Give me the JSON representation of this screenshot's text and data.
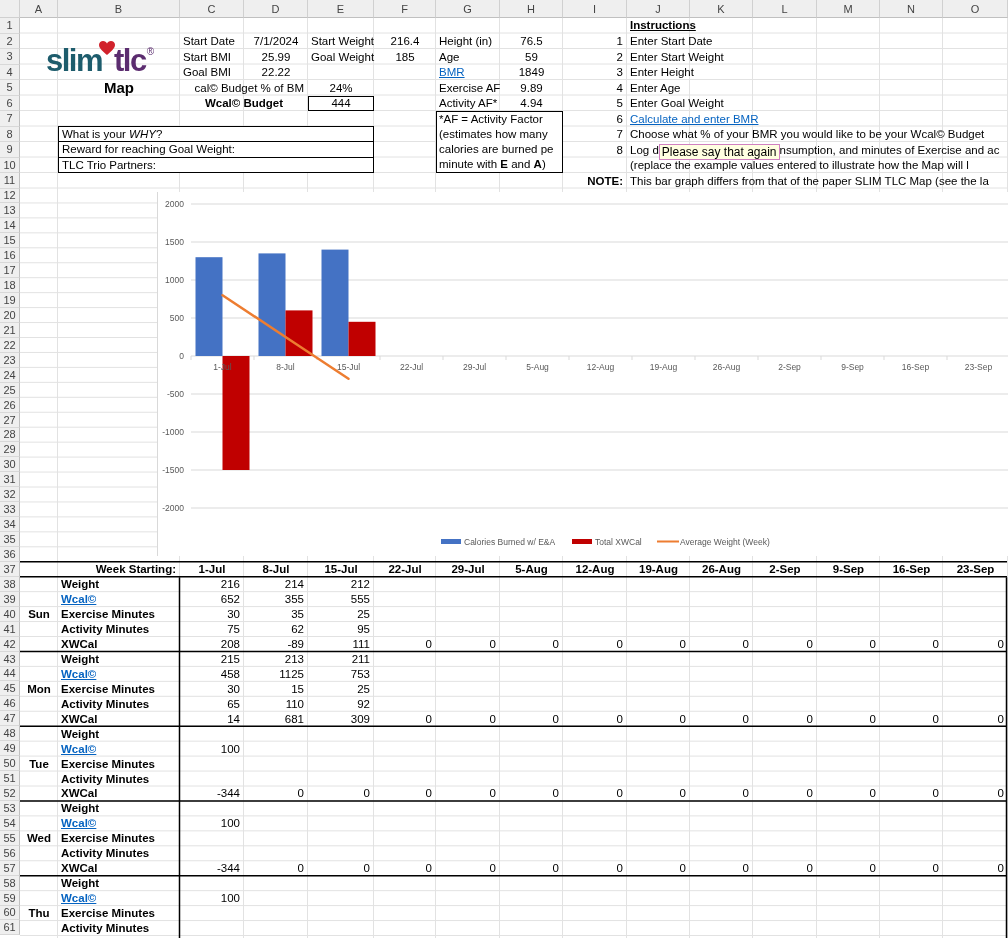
{
  "column_headers": [
    "A",
    "B",
    "C",
    "D",
    "E",
    "F",
    "G",
    "H",
    "I",
    "J",
    "K",
    "L",
    "M",
    "N",
    "O"
  ],
  "row_numbers": [
    "1",
    "2",
    "3",
    "4",
    "5",
    "6",
    "7",
    "8",
    "9",
    "10",
    "11",
    "12",
    "13",
    "14",
    "15",
    "16",
    "17",
    "18",
    "19",
    "20",
    "21",
    "22",
    "23",
    "24",
    "25",
    "26",
    "27",
    "28",
    "29",
    "30",
    "31",
    "32",
    "33",
    "34",
    "35",
    "36",
    "37",
    "38",
    "39",
    "40",
    "41",
    "42",
    "43",
    "44",
    "45",
    "46",
    "47",
    "48",
    "49",
    "50",
    "51",
    "52",
    "53",
    "54",
    "55",
    "56",
    "57",
    "58",
    "59",
    "60",
    "61"
  ],
  "logo": {
    "left": "slim",
    "right": "tlc",
    "mark": "®"
  },
  "map_title": "Map",
  "profile": {
    "left": [
      {
        "label": "Start Date",
        "value": "7/1/2024"
      },
      {
        "label": "Start BMI",
        "value": "25.99"
      },
      {
        "label": "Goal BMI",
        "value": "22.22"
      }
    ],
    "right": [
      {
        "label": "Start Weight",
        "value": "216.4"
      },
      {
        "label": "Goal Weight",
        "value": "185"
      }
    ],
    "budget_percent": {
      "label": "cal© Budget % of BM",
      "value": "24%"
    },
    "budget": {
      "label": "Wcal© Budget",
      "value": "444"
    }
  },
  "prompts": [
    "What is your *WHY*?",
    "Reward for reaching Goal Weight:",
    "TLC Trio Partners:"
  ],
  "metrics": [
    {
      "label": "Height (in)",
      "value": "76.5",
      "kind": "plain"
    },
    {
      "label": "Age",
      "value": "59",
      "kind": "plain"
    },
    {
      "label": "BMR",
      "value": "1849",
      "kind": "link"
    },
    {
      "label": "Exercise AF",
      "value": "9.89",
      "kind": "plain"
    },
    {
      "label": "Activity AF*",
      "value": "4.94",
      "kind": "plain"
    }
  ],
  "af_note": [
    "*AF = Activity Factor",
    "(estimates how many",
    "calories are burned pe",
    "minute with **E** and **A**)"
  ],
  "instructions": {
    "title": "Instructions",
    "steps": [
      {
        "number": "1",
        "text": "Enter Start Date",
        "kind": "plain"
      },
      {
        "number": "2",
        "text": "Enter Start Weight",
        "kind": "plain"
      },
      {
        "number": "3",
        "text": "Enter Height",
        "kind": "plain"
      },
      {
        "number": "4",
        "text": "Enter Age",
        "kind": "plain"
      },
      {
        "number": "5",
        "text": "Enter Goal Weight",
        "kind": "plain"
      },
      {
        "number": "6",
        "text": "Calculate and enter BMR",
        "kind": "link"
      },
      {
        "number": "7",
        "text": "Choose what % of your BMR you would like to be your Wcal© Budget",
        "kind": "plain"
      },
      {
        "number": "8",
        "text": "Log d",
        "kind": "tooltip",
        "tooltip": "Please say that again",
        "text_after": "nsumption, and minutes of Exercise and ac"
      }
    ],
    "continuation": "(replace the example values entered to illustrate how the Map will l",
    "note": {
      "label": "NOTE:",
      "text": "This bar graph differs from that of the paper SLIM TLC Map (see the la"
    }
  },
  "chart": {
    "chart_data": {
      "type": "bar",
      "categories": [
        "1-Jul",
        "8-Jul",
        "15-Jul",
        "22-Jul",
        "29-Jul",
        "5-Aug",
        "12-Aug",
        "19-Aug",
        "26-Aug",
        "2-Sep",
        "9-Sep",
        "16-Sep",
        "23-Sep"
      ],
      "series": [
        {
          "name": "Calories Burned w/ E&A",
          "color": "#4472c4",
          "values": [
            1300,
            1350,
            1400,
            null,
            null,
            null,
            null,
            null,
            null,
            null,
            null,
            null,
            null
          ]
        },
        {
          "name": "Total XWCal",
          "color": "#c00000",
          "values": [
            -1500,
            600,
            450,
            null,
            null,
            null,
            null,
            null,
            null,
            null,
            null,
            null,
            null
          ]
        },
        {
          "name": "Average Weight (Week)",
          "color": "#ed7d31",
          "type": "line",
          "values": [
            800,
            250,
            -300,
            null,
            null,
            null,
            null,
            null,
            null,
            null,
            null,
            null,
            null
          ]
        }
      ],
      "ylim": [
        -2000,
        2000
      ],
      "grid": true,
      "legend": true,
      "yticks": [
        -2000,
        -1500,
        -1000,
        -500,
        0,
        500,
        1000,
        1500,
        2000
      ]
    }
  },
  "week_table": {
    "header": "Week Starting:",
    "weeks": [
      "1-Jul",
      "8-Jul",
      "15-Jul",
      "22-Jul",
      "29-Jul",
      "5-Aug",
      "12-Aug",
      "19-Aug",
      "26-Aug",
      "2-Sep",
      "9-Sep",
      "16-Sep",
      "23-Sep"
    ],
    "days": [
      {
        "day": "Sun",
        "rows": [
          {
            "label": "Weight",
            "kind": "plain",
            "values": [
              "216",
              "214",
              "212"
            ]
          },
          {
            "label": "Wcal©",
            "kind": "link",
            "values": [
              "652",
              "355",
              "555"
            ]
          },
          {
            "label": "Exercise Minutes",
            "kind": "plain",
            "values": [
              "30",
              "35",
              "25"
            ]
          },
          {
            "label": "Activity Minutes",
            "kind": "plain",
            "values": [
              "75",
              "62",
              "95"
            ]
          },
          {
            "label": "XWCal",
            "kind": "plain",
            "values": [
              "208",
              "-89",
              "111",
              "0",
              "0",
              "0",
              "0",
              "0",
              "0",
              "0",
              "0",
              "0",
              "0"
            ]
          }
        ]
      },
      {
        "day": "Mon",
        "rows": [
          {
            "label": "Weight",
            "kind": "plain",
            "values": [
              "215",
              "213",
              "211"
            ]
          },
          {
            "label": "Wcal©",
            "kind": "link",
            "values": [
              "458",
              "1125",
              "753"
            ]
          },
          {
            "label": "Exercise Minutes",
            "kind": "plain",
            "values": [
              "30",
              "15",
              "25"
            ]
          },
          {
            "label": "Activity Minutes",
            "kind": "plain",
            "values": [
              "65",
              "110",
              "92"
            ]
          },
          {
            "label": "XWCal",
            "kind": "plain",
            "values": [
              "14",
              "681",
              "309",
              "0",
              "0",
              "0",
              "0",
              "0",
              "0",
              "0",
              "0",
              "0",
              "0"
            ]
          }
        ]
      },
      {
        "day": "Tue",
        "rows": [
          {
            "label": "Weight",
            "kind": "plain"
          },
          {
            "label": "Wcal©",
            "kind": "link",
            "values": [
              "100"
            ]
          },
          {
            "label": "Exercise Minutes",
            "kind": "plain"
          },
          {
            "label": "Activity Minutes",
            "kind": "plain"
          },
          {
            "label": "XWCal",
            "kind": "plain",
            "values": [
              "-344",
              "0",
              "0",
              "0",
              "0",
              "0",
              "0",
              "0",
              "0",
              "0",
              "0",
              "0",
              "0"
            ]
          }
        ]
      },
      {
        "day": "Wed",
        "rows": [
          {
            "label": "Weight",
            "kind": "plain"
          },
          {
            "label": "Wcal©",
            "kind": "link",
            "values": [
              "100"
            ]
          },
          {
            "label": "Exercise Minutes",
            "kind": "plain"
          },
          {
            "label": "Activity Minutes",
            "kind": "plain"
          },
          {
            "label": "XWCal",
            "kind": "plain",
            "values": [
              "-344",
              "0",
              "0",
              "0",
              "0",
              "0",
              "0",
              "0",
              "0",
              "0",
              "0",
              "0",
              "0"
            ]
          }
        ]
      },
      {
        "day": "Thu",
        "rows": [
          {
            "label": "Weight",
            "kind": "plain"
          },
          {
            "label": "Wcal©",
            "kind": "link",
            "values": [
              "100"
            ]
          },
          {
            "label": "Exercise Minutes",
            "kind": "plain"
          },
          {
            "label": "Activity Minutes",
            "kind": "plain"
          }
        ]
      }
    ]
  }
}
